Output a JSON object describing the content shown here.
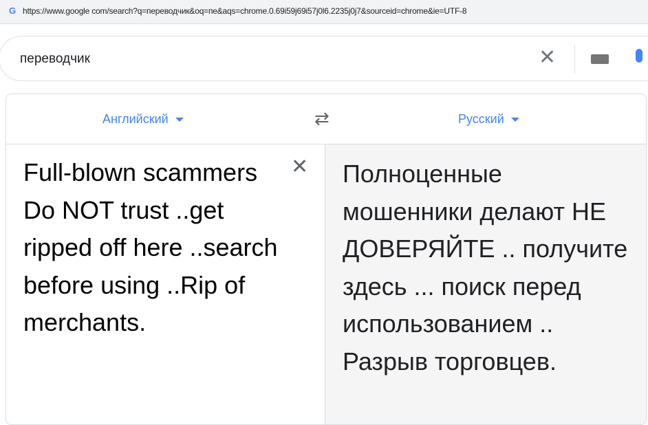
{
  "browser": {
    "url": "https://www.google com/search?q=переводчик&oq=пе&aqs=chrome.0.69i59j69i57j0l6.2235j0j7&sourceid=chrome&ie=UTF-8",
    "favicon": "G"
  },
  "search": {
    "query": "переводчик",
    "clear_icon": "✕"
  },
  "translator": {
    "source_lang": "Английский",
    "target_lang": "Русский",
    "swap_icon": "⇄",
    "clear_icon": "✕",
    "source_text": "Full-blown scammers Do NOT trust ..get ripped off here ..search before using ..Rip of merchants.",
    "target_text": "Полноценные мошенники делают НЕ ДОВЕРЯЙТЕ .. получите здесь ... поиск перед использованием .. Разрыв торговцев."
  }
}
